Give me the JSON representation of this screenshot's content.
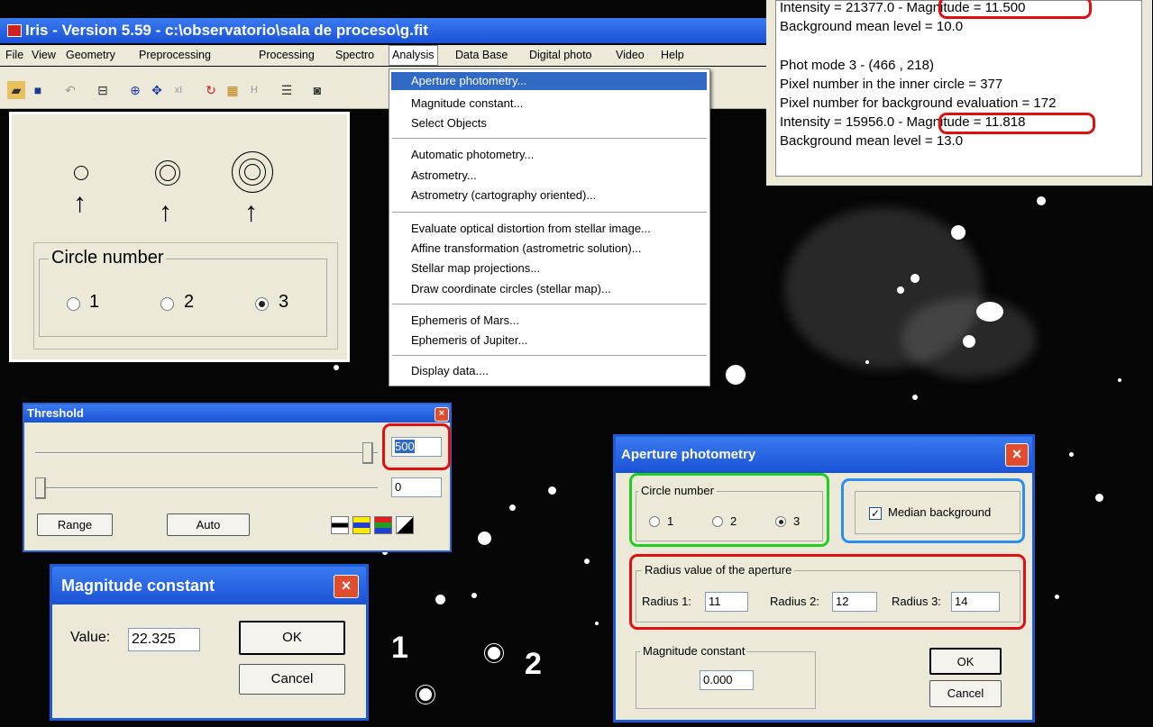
{
  "main_window": {
    "title": "Iris - Version 5.59 - c:\\observatorio\\sala de proceso\\g.fit",
    "menu": [
      "File",
      "View",
      "Geometry",
      "Preprocessing",
      "Processing",
      "Spectro",
      "Analysis",
      "Data Base",
      "Digital photo",
      "Video",
      "Help"
    ]
  },
  "analysis_menu": {
    "items": [
      "Aperture photometry...",
      "Magnitude constant...",
      "Select Objects",
      "Automatic photometry...",
      "Astrometry...",
      "Astrometry (cartography oriented)...",
      "Evaluate optical distortion from stellar image...",
      "Affine transformation (astrometric solution)...",
      "Stellar map projections...",
      "Draw coordinate circles (stellar map)...",
      "Ephemeris of Mars...",
      "Ephemeris of Jupiter...",
      "Display data...."
    ]
  },
  "circle_panel": {
    "legend": "Circle number",
    "options": [
      "1",
      "2",
      "3"
    ],
    "selected": "3"
  },
  "info_panel": {
    "lines": [
      "Intensity = 21377.0  - Magnitude = 11.500",
      "Background mean level = 10.0",
      "",
      "Phot mode 3  -  (466 , 218)",
      "Pixel number in the inner circle = 377",
      "Pixel number for background evaluation = 172",
      "Intensity = 15956.0  - Magnitude = 11.818",
      "Background mean level = 13.0"
    ]
  },
  "threshold": {
    "title": "Threshold",
    "high_value": "500",
    "low_value": "0",
    "high_level": 0.98,
    "low_level": 0.0,
    "range_label": "Range",
    "auto_label": "Auto",
    "close": "×"
  },
  "magnitude_constant": {
    "title": "Magnitude constant",
    "value_label": "Value:",
    "value": "22.325",
    "ok": "OK",
    "cancel": "Cancel",
    "close": "×"
  },
  "aperture": {
    "title": "Aperture photometry",
    "circle_legend": "Circle number",
    "options": [
      "1",
      "2",
      "3"
    ],
    "selected": "3",
    "median_label": "Median background",
    "median_checked": true,
    "radius_legend": "Radius value of the aperture",
    "radius1_label": "Radius 1:",
    "radius1": "11",
    "radius2_label": "Radius 2:",
    "radius2": "12",
    "radius3_label": "Radius 3:",
    "radius3": "14",
    "magconst_legend": "Magnitude constant",
    "magconst": "0.000",
    "ok": "OK",
    "cancel": "Cancel",
    "close": "×"
  },
  "annotations": {
    "star1": "1",
    "star2": "2"
  },
  "colors": {
    "highlight_red": "#e01010",
    "highlight_green": "#22cc22",
    "highlight_blue": "#2a8ef0",
    "titlebar_blue": "#1f5ad6"
  }
}
